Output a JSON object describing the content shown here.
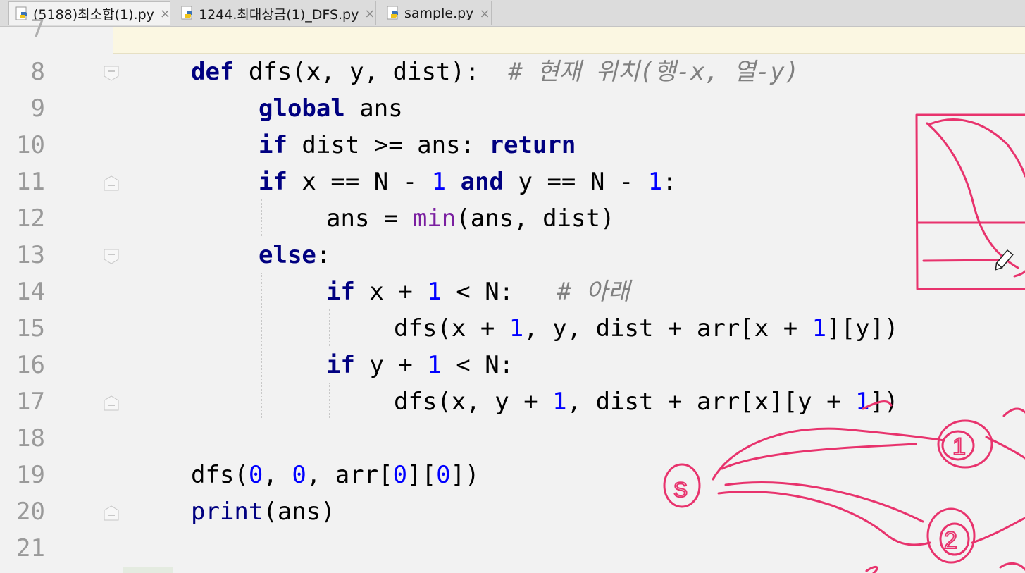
{
  "tabs": [
    {
      "label": "(5188)최소합(1).py",
      "active": true,
      "close": "×",
      "icon": "python-file-icon"
    },
    {
      "label": "1244.최대상금(1)_DFS.py",
      "active": false,
      "close": "×",
      "icon": "python-file-icon"
    },
    {
      "label": "sample.py",
      "active": false,
      "close": "×",
      "icon": "python-file-icon"
    }
  ],
  "editor": {
    "partial_top_line_number": "7",
    "lines": [
      {
        "n": "8"
      },
      {
        "n": "9"
      },
      {
        "n": "10"
      },
      {
        "n": "11"
      },
      {
        "n": "12"
      },
      {
        "n": "13"
      },
      {
        "n": "14"
      },
      {
        "n": "15"
      },
      {
        "n": "16"
      },
      {
        "n": "17"
      },
      {
        "n": "18"
      },
      {
        "n": "19"
      },
      {
        "n": "20"
      },
      {
        "n": "21"
      }
    ],
    "tokens": {
      "l8_def": "def",
      "l8_sig": " dfs(x, y, dist):  ",
      "l8_comment": "# 현재 위치(행-x, 열-y)",
      "l9_global": "global",
      "l9_rest": " ans",
      "l10_if": "if",
      "l10_mid": " dist >= ans: ",
      "l10_return": "return",
      "l11_if": "if",
      "l11_a": " x == N - ",
      "l11_one": "1",
      "l11_and": " and",
      "l11_b": " y == N - ",
      "l11_one2": "1",
      "l11_c": ":",
      "l12": "ans = ",
      "l12_min": "min",
      "l12_rest": "(ans, dist)",
      "l13_else": "else",
      "l13_colon": ":",
      "l14_if": "if",
      "l14_a": " x + ",
      "l14_one": "1",
      "l14_b": " < N:   ",
      "l14_comment": "# 아래",
      "l15_a": "dfs(x + ",
      "l15_one": "1",
      "l15_b": ", y, dist + arr[x + ",
      "l15_one2": "1",
      "l15_c": "][y])",
      "l16_if": "if",
      "l16_a": " y + ",
      "l16_one": "1",
      "l16_b": " < N:",
      "l17_a": "dfs(x, y + ",
      "l17_one": "1",
      "l17_b": ", dist + arr[x][y + ",
      "l17_one2": "1",
      "l17_c": "])",
      "l19_a": "dfs(",
      "l19_z1": "0",
      "l19_b": ", ",
      "l19_z2": "0",
      "l19_c": ", arr[",
      "l19_z3": "0",
      "l19_d": "][",
      "l19_z4": "0",
      "l19_e": "])",
      "l20_print": "print",
      "l20_rest": "(ans)"
    }
  },
  "colors": {
    "keyword": "#000080",
    "number": "#0000ff",
    "comment": "#808080",
    "annotation_pen": "#e8336d",
    "caret_row": "#fbf7e2"
  },
  "handwriting": {
    "labels": [
      "S",
      "1",
      "2"
    ],
    "icon": "pen-cursor-icon"
  }
}
